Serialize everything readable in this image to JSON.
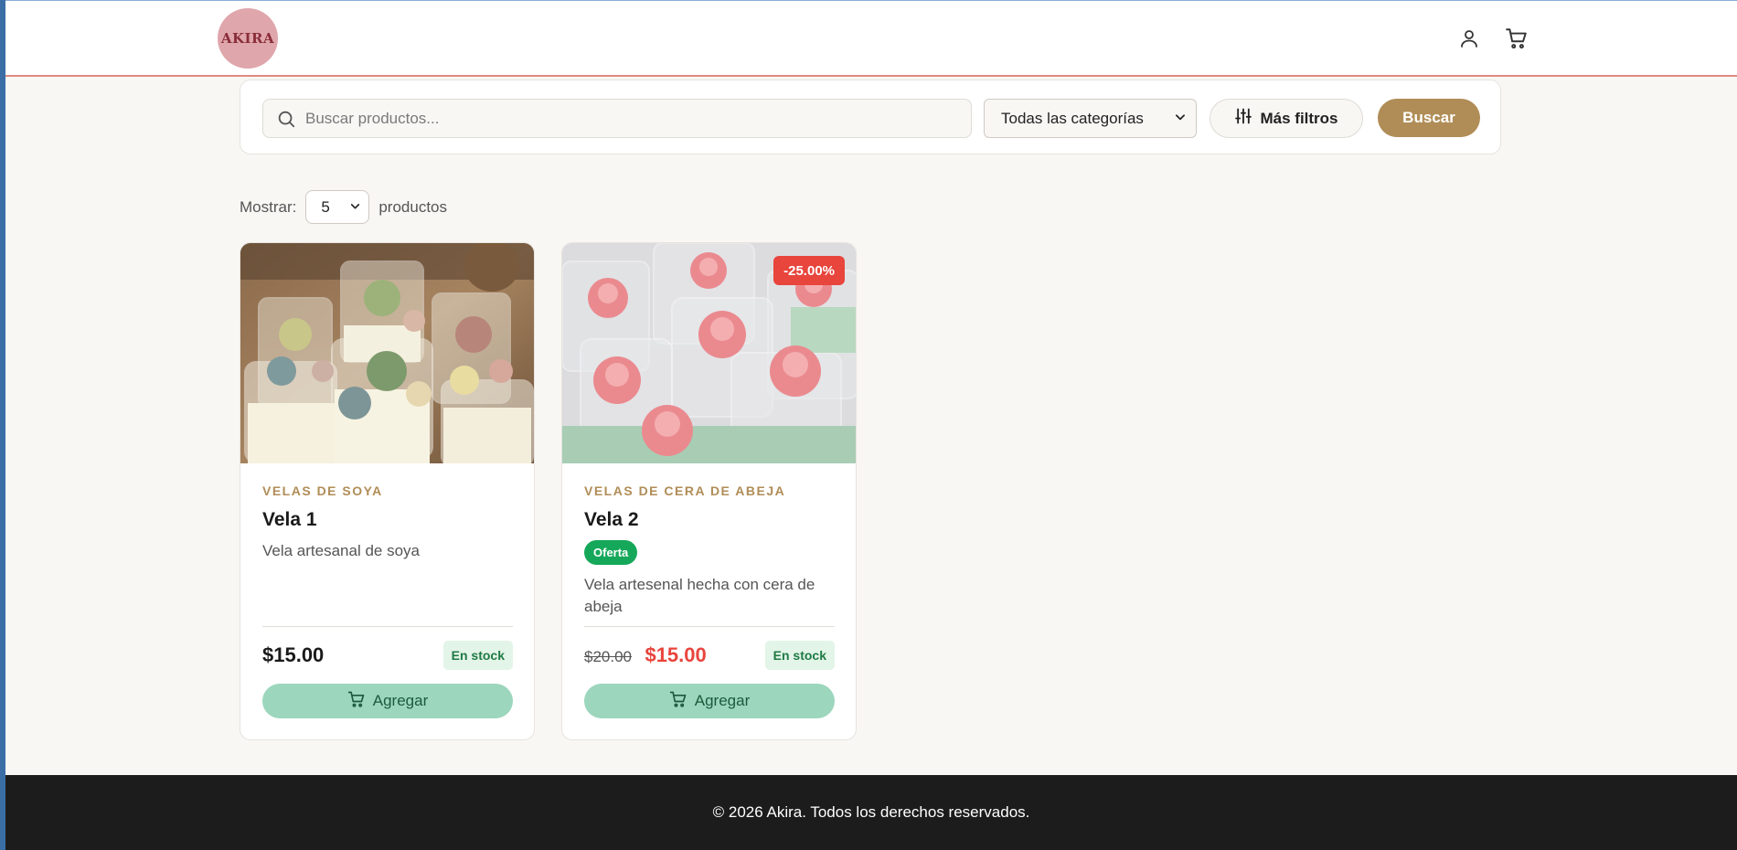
{
  "header": {
    "logo_text": "AKIRA",
    "icons": [
      "user-icon",
      "cart-icon"
    ]
  },
  "search": {
    "placeholder": "Buscar productos...",
    "category_selected": "Todas las categorías",
    "more_filters_label": "Más filtros",
    "search_button_label": "Buscar"
  },
  "show": {
    "prefix": "Mostrar:",
    "value": "5",
    "suffix": "productos"
  },
  "products": [
    {
      "category": "VELAS DE SOYA",
      "name": "Vela 1",
      "description": "Vela artesanal de soya",
      "price": "$15.00",
      "stock": "En stock",
      "add_label": "Agregar"
    },
    {
      "category": "VELAS DE CERA DE ABEJA",
      "name": "Vela 2",
      "discount": "-25.00%",
      "offer_badge": "Oferta",
      "description": "Vela artesenal hecha con cera de abeja",
      "old_price": "$20.00",
      "price": "$15.00",
      "stock": "En stock",
      "add_label": "Agregar"
    }
  ],
  "footer": {
    "text": "© 2026 Akira. Todos los derechos reservados."
  },
  "colors": {
    "accent": "#b08d57",
    "sale": "#e8453c",
    "add_button": "#9cd6bd",
    "offer_green": "#16a85a",
    "footer_bg": "#1c1c1c"
  }
}
